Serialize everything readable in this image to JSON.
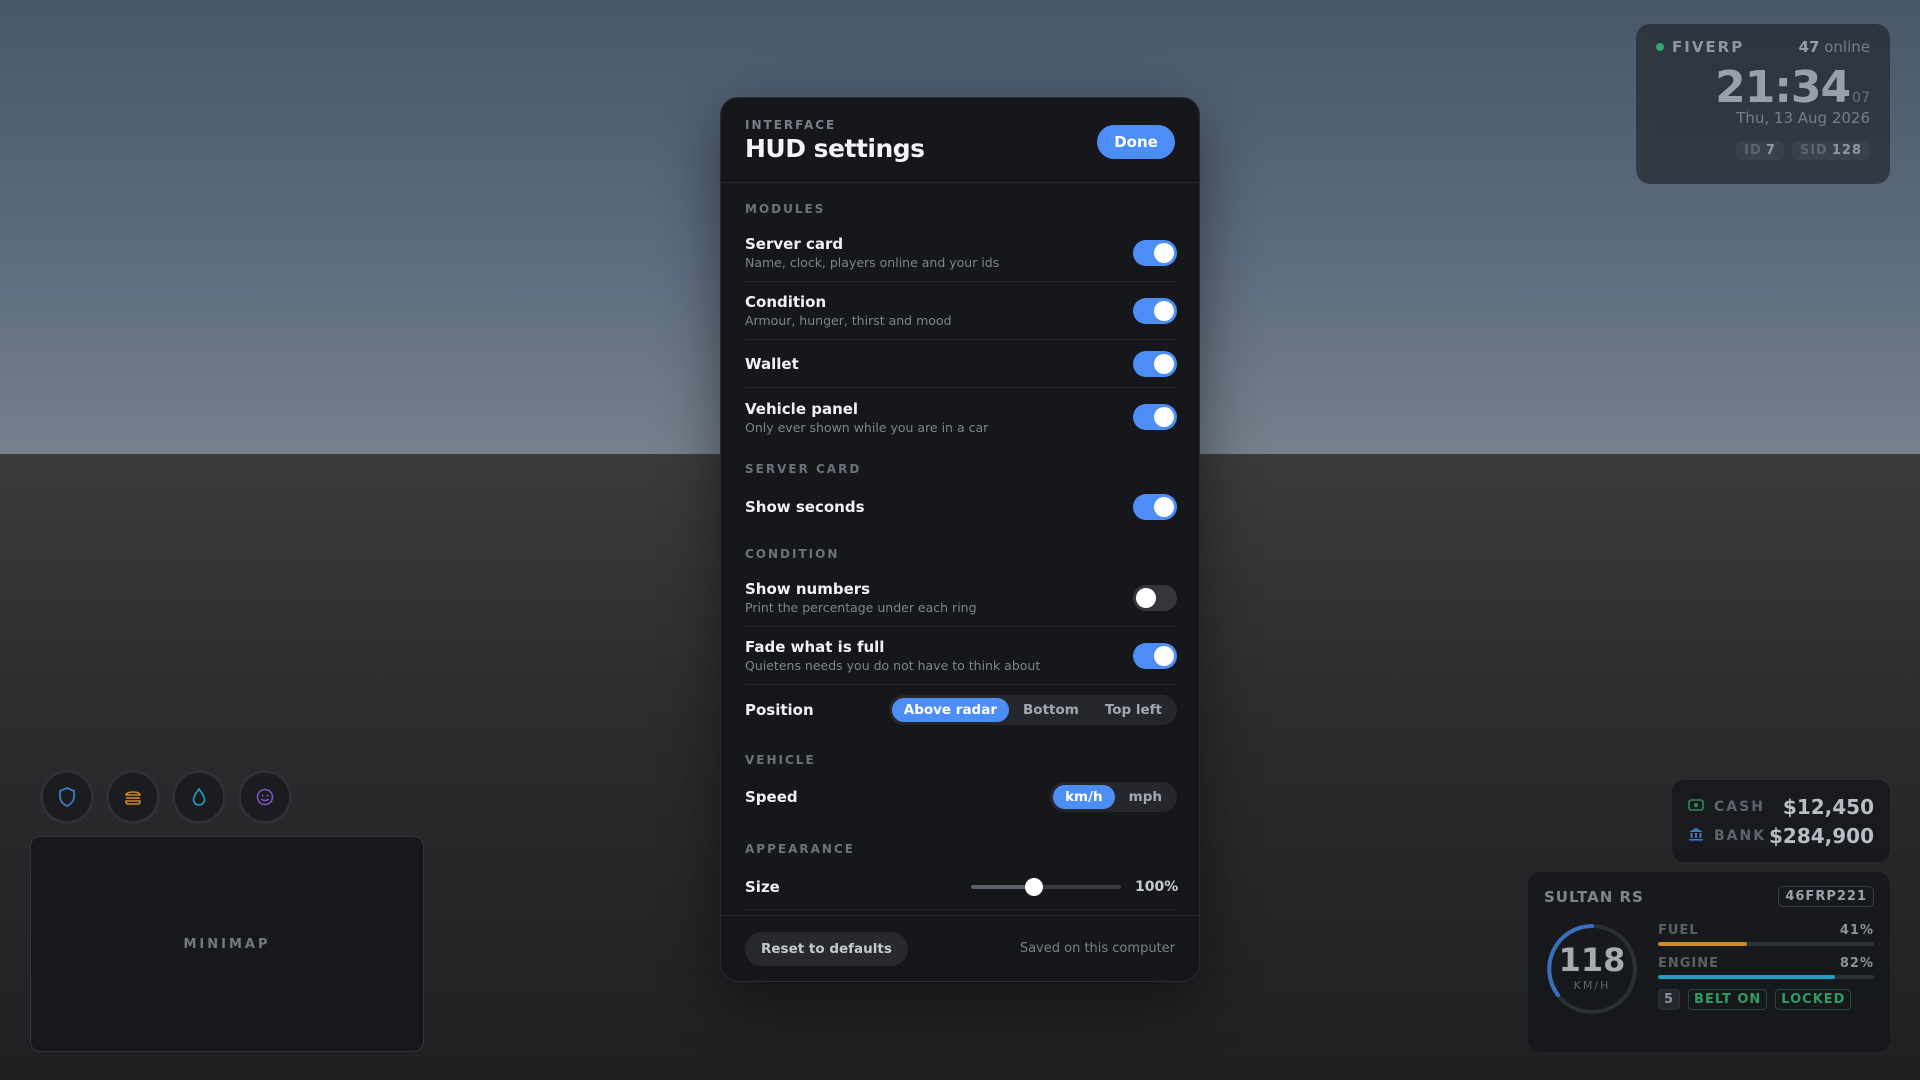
{
  "server_card": {
    "name": "FIVERP",
    "online_count": "47",
    "online_label": "online",
    "time_hm": "21:34",
    "time_seconds": "07",
    "date": "Thu, 13 Aug 2026",
    "id_label": "ID",
    "id_value": "7",
    "sid_label": "SID",
    "sid_value": "128",
    "status_color": "#2bb673"
  },
  "wallet": {
    "cash_label": "CASH",
    "cash_value": "$12,450",
    "bank_label": "BANK",
    "bank_value": "$284,900"
  },
  "vehicle": {
    "name": "SULTAN RS",
    "plate": "46FRP221",
    "speed": "118",
    "speed_unit": "KM/H",
    "fuel_label": "FUEL",
    "fuel_value": "41%",
    "fuel_fraction": 0.41,
    "fuel_color": "#c98a2a",
    "engine_label": "ENGINE",
    "engine_value": "82%",
    "engine_fraction": 0.82,
    "engine_color": "#1f9fc4",
    "gear": "5",
    "belt": "BELT ON",
    "lock": "LOCKED"
  },
  "condition_rings": [
    {
      "icon": "shield-icon",
      "color": "#3f78c9"
    },
    {
      "icon": "burger-icon",
      "color": "#c98a2a"
    },
    {
      "icon": "water-drop-icon",
      "color": "#1f9fc4"
    },
    {
      "icon": "smiley-icon",
      "color": "#7a52c9"
    }
  ],
  "minimap": {
    "label": "MINIMAP"
  },
  "modal": {
    "eyebrow": "INTERFACE",
    "title": "HUD settings",
    "done_label": "Done",
    "sections": {
      "modules": "MODULES",
      "server_card": "SERVER CARD",
      "condition": "CONDITION",
      "vehicle": "VEHICLE",
      "appearance": "APPEARANCE"
    },
    "rows": {
      "server_card": {
        "title": "Server card",
        "sub": "Name, clock, players online and your ids",
        "on": true
      },
      "condition": {
        "title": "Condition",
        "sub": "Armour, hunger, thirst and mood",
        "on": true
      },
      "wallet": {
        "title": "Wallet",
        "on": true
      },
      "vehicle_panel": {
        "title": "Vehicle panel",
        "sub": "Only ever shown while you are in a car",
        "on": true
      },
      "show_seconds": {
        "title": "Show seconds",
        "on": true
      },
      "show_numbers": {
        "title": "Show numbers",
        "sub": "Print the percentage under each ring",
        "on": false
      },
      "fade_full": {
        "title": "Fade what is full",
        "sub": "Quietens needs you do not have to think about",
        "on": true
      },
      "position": {
        "title": "Position",
        "options": [
          "Above radar",
          "Bottom",
          "Top left"
        ],
        "selected": "Above radar"
      },
      "speed": {
        "title": "Speed",
        "options": [
          "km/h",
          "mph"
        ],
        "selected": "km/h"
      },
      "size": {
        "title": "Size",
        "value": "100%",
        "fraction": 0.42
      }
    },
    "reset_label": "Reset to defaults",
    "saved_label": "Saved on this computer",
    "accent": "#4c8df6"
  }
}
